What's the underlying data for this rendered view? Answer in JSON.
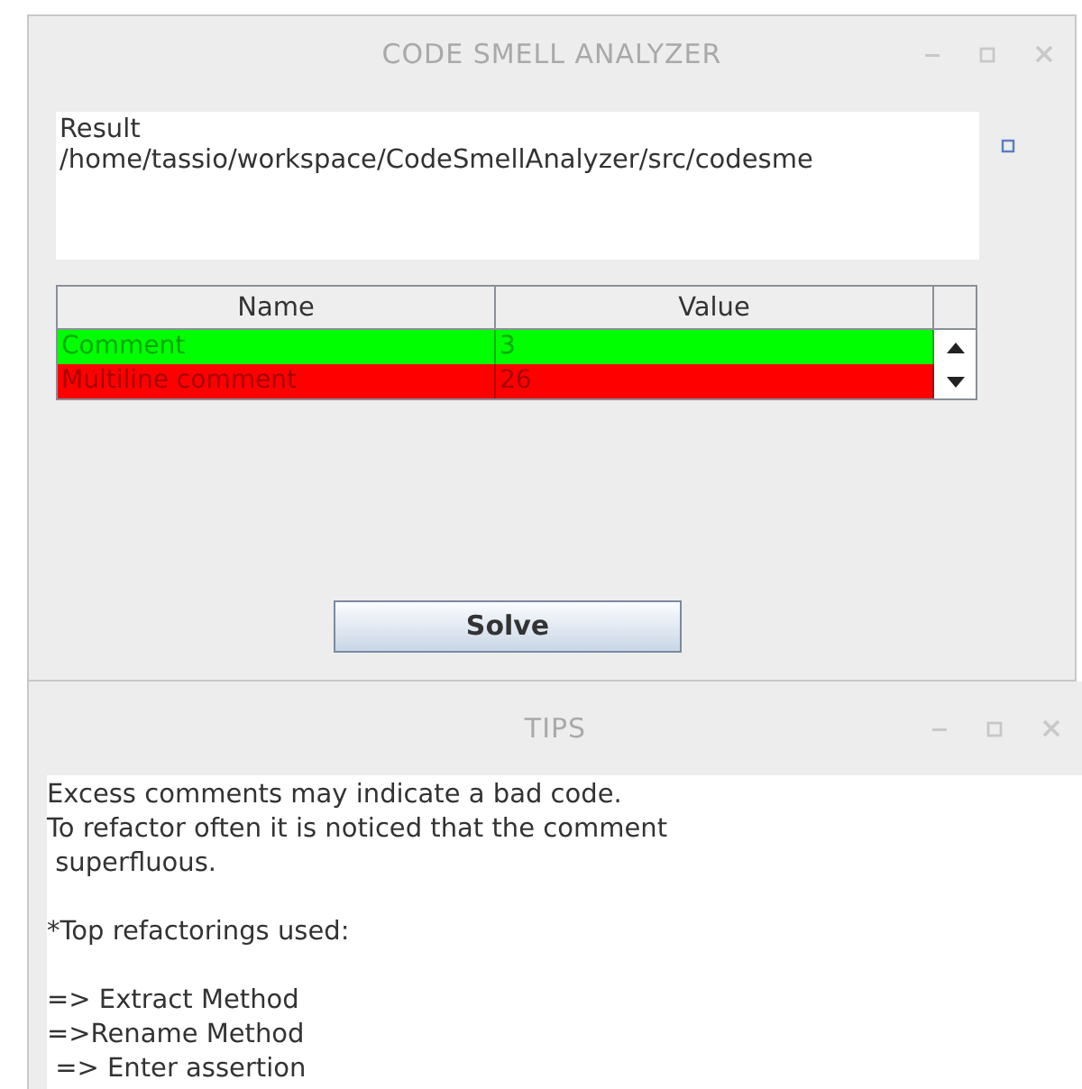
{
  "main_window": {
    "title": "CODE SMELL ANALYZER",
    "result": {
      "label": "Result",
      "path": "/home/tassio/workspace/CodeSmellAnalyzer/src/codesme"
    },
    "table": {
      "columns": [
        "Name",
        "Value"
      ],
      "rows": [
        {
          "name": "Comment",
          "value": "3",
          "color": "#00ff00"
        },
        {
          "name": "Multiline comment",
          "value": "26",
          "color": "#ff0000"
        }
      ]
    },
    "button": "Solve"
  },
  "tips_window": {
    "title": "TIPS",
    "paragraphs": [
      [
        "Excess comments may indicate a bad code.",
        "To refactor often it is noticed that the comment",
        " superfluous."
      ],
      [
        "*Top refactorings used:"
      ],
      [
        "=> Extract Method",
        "=>Rename Method",
        " => Enter assertion"
      ]
    ]
  }
}
